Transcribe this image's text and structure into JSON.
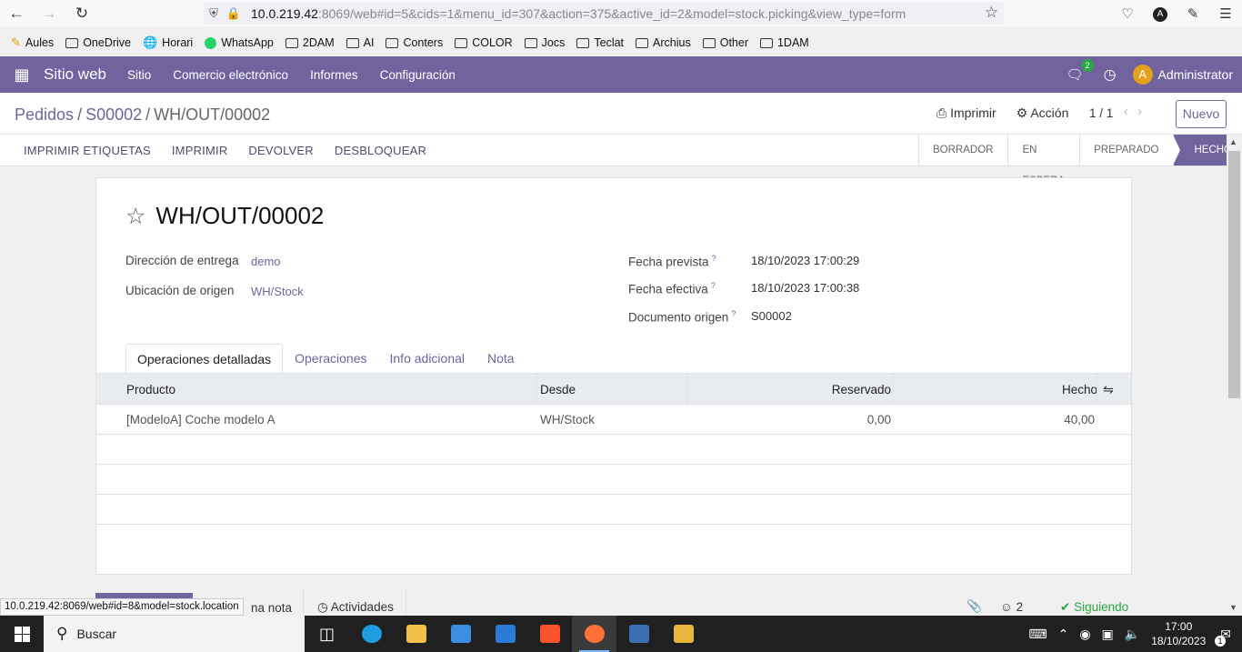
{
  "browser": {
    "url_host": "10.0.219.42",
    "url_rest": ":8069/web#id=5&cids=1&menu_id=307&action=375&active_id=2&model=stock.picking&view_type=form",
    "profile_initial": "A",
    "status_url": "10.0.219.42:8069/web#id=8&model=stock.location"
  },
  "bookmarks": [
    {
      "label": "Aules",
      "icon": "note-icon"
    },
    {
      "label": "OneDrive",
      "icon": "folder-icon"
    },
    {
      "label": "Horari",
      "icon": "globe-icon"
    },
    {
      "label": "WhatsApp",
      "icon": "whatsapp-icon"
    },
    {
      "label": "2DAM",
      "icon": "folder-icon"
    },
    {
      "label": "AI",
      "icon": "folder-icon"
    },
    {
      "label": "Conters",
      "icon": "folder-icon"
    },
    {
      "label": "COLOR",
      "icon": "folder-icon"
    },
    {
      "label": "Jocs",
      "icon": "folder-icon"
    },
    {
      "label": "Teclat",
      "icon": "folder-icon"
    },
    {
      "label": "Archius",
      "icon": "folder-icon"
    },
    {
      "label": "Other",
      "icon": "folder-icon"
    },
    {
      "label": "1DAM",
      "icon": "folder-icon"
    }
  ],
  "navbar": {
    "app_name": "Sitio web",
    "menu": [
      "Sitio",
      "Comercio electrónico",
      "Informes",
      "Configuración"
    ],
    "chat_badge": "2",
    "user_initial": "A",
    "user_name": "Administrator",
    "brand_color": "#71639e"
  },
  "control_panel": {
    "breadcrumb": [
      "Pedidos",
      "S00002",
      "WH/OUT/00002"
    ],
    "print_label": "Imprimir",
    "action_label": "Acción",
    "pager": "1 / 1",
    "new_label": "Nuevo"
  },
  "statusbar": {
    "buttons": [
      "IMPRIMIR ETIQUETAS",
      "IMPRIMIR",
      "DEVOLVER",
      "DESBLOQUEAR"
    ],
    "stages": [
      "BORRADOR",
      "EN ESPERA",
      "PREPARADO",
      "HECHO"
    ],
    "active_stage": "HECHO"
  },
  "form": {
    "title": "WH/OUT/00002",
    "left_fields": [
      {
        "label": "Dirección de entrega",
        "value": "demo"
      },
      {
        "label": "Ubicación de origen",
        "value": "WH/Stock"
      }
    ],
    "right_fields": [
      {
        "label": "Fecha prevista",
        "value": "18/10/2023 17:00:29"
      },
      {
        "label": "Fecha efectiva",
        "value": "18/10/2023 17:00:38"
      },
      {
        "label": "Documento origen",
        "value": "S00002"
      }
    ],
    "help_mark": "?",
    "tabs": [
      "Operaciones detalladas",
      "Operaciones",
      "Info adicional",
      "Nota"
    ],
    "active_tab": "Operaciones detalladas"
  },
  "table": {
    "columns": [
      "Producto",
      "Desde",
      "Reservado",
      "Hecho"
    ],
    "rows": [
      {
        "producto": "[ModeloA] Coche modelo A",
        "desde": "WH/Stock",
        "reservado": "0,00",
        "hecho": "40,00"
      }
    ]
  },
  "chatter": {
    "log_note": "na nota",
    "activities": "Actividades",
    "followers": "2",
    "following": "Siguiendo"
  },
  "taskbar": {
    "search_placeholder": "Buscar",
    "time": "17:00",
    "date": "18/10/2023",
    "notif_count": "1"
  }
}
